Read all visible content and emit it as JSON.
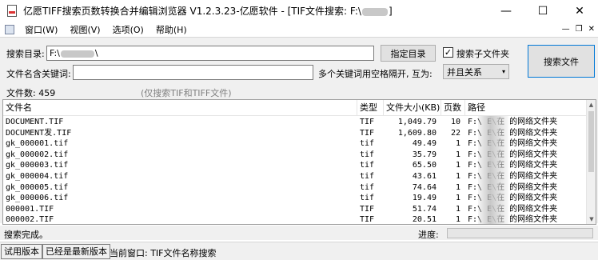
{
  "window": {
    "title_prefix": "亿愿TIFF搜索页数转换合并编辑浏览器 V1.2.3.23-亿愿软件 - [TIF文件搜索: F:\\",
    "title_suffix": "]",
    "minimize": "—",
    "maximize": "☐",
    "close": "✕"
  },
  "menu": {
    "items": [
      "窗口(W)",
      "视图(V)",
      "选项(O)",
      "帮助(H)"
    ],
    "mdi_minimize": "—",
    "mdi_restore": "❐",
    "mdi_close": "✕"
  },
  "search": {
    "dir_label": "搜索目录:",
    "dir_value": "F:\\",
    "dir_value_suffix": "\\",
    "choose_dir_button": "指定目录",
    "include_sub_label": "搜索子文件夹",
    "include_sub_checked": "✓",
    "search_button": "搜索文件",
    "keyword_label": "文件名含关键词:",
    "keyword_value": "",
    "keyword_hint": "多个关键词用空格隔开, 互为:",
    "relation_value": "并且关系",
    "count_label": "文件数: 459",
    "count_hint": "(仅搜索TIF和TIFF文件)"
  },
  "table": {
    "columns": [
      "文件名",
      "类型",
      "文件大小(KB)",
      "页数",
      "路径"
    ],
    "rows": [
      {
        "name": "DOCUMENT.TIF",
        "type": "TIF",
        "size": "1,049.79",
        "pages": "10",
        "path": "F:\\      E\\在      的网络文件夹"
      },
      {
        "name": "DOCUMENT发.TIF",
        "type": "TIF",
        "size": "1,609.80",
        "pages": "22",
        "path": "F:\\      E\\在      的网络文件夹"
      },
      {
        "name": "gk_000001.tif",
        "type": "tif",
        "size": "49.49",
        "pages": "1",
        "path": "F:\\      E\\在      的网络文件夹"
      },
      {
        "name": "gk_000002.tif",
        "type": "tif",
        "size": "35.79",
        "pages": "1",
        "path": "F:\\      E\\在      的网络文件夹"
      },
      {
        "name": "gk_000003.tif",
        "type": "tif",
        "size": "65.50",
        "pages": "1",
        "path": "F:\\      E\\在      的网络文件夹"
      },
      {
        "name": "gk_000004.tif",
        "type": "tif",
        "size": "43.61",
        "pages": "1",
        "path": "F:\\      E\\在      的网络文件夹"
      },
      {
        "name": "gk_000005.tif",
        "type": "tif",
        "size": "74.64",
        "pages": "1",
        "path": "F:\\      E\\在      的网络文件夹"
      },
      {
        "name": "gk_000006.tif",
        "type": "tif",
        "size": "19.49",
        "pages": "1",
        "path": "F:\\      E\\在      的网络文件夹"
      },
      {
        "name": "000001.TIF",
        "type": "TIF",
        "size": "51.74",
        "pages": "1",
        "path": "F:\\      E\\在      的网络文件夹"
      },
      {
        "name": "000002.TIF",
        "type": "TIF",
        "size": "20.51",
        "pages": "1",
        "path": "F:\\      E\\在      的网络文件夹"
      }
    ]
  },
  "status": {
    "message": "搜索完成。",
    "progress_label": "进度:",
    "progress_fraction": 0
  },
  "bottom": {
    "trial_button": "试用版本",
    "latest_button": "已经是最新版本",
    "current_window": "当前窗口: TIF文件名称搜索"
  }
}
